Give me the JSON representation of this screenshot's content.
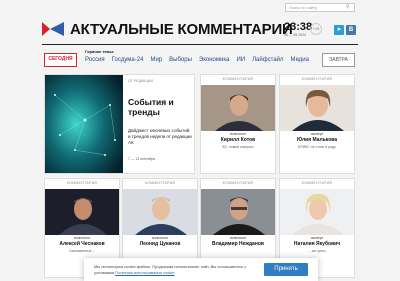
{
  "search": {
    "placeholder": "Поиск по сайту"
  },
  "header": {
    "title": "АКТУАЛЬНЫЕ КОММЕНТАРИИ",
    "time": "23:38",
    "date": "05 … 05 2024",
    "weather": "+15",
    "tg": "tg",
    "vk": "В"
  },
  "nav": {
    "today": "СЕГОДНЯ",
    "tomorrow": "ЗАВТРА",
    "hot_label": "Горячие темы:",
    "items": [
      "Россия",
      "Госдума-24",
      "Мир",
      "Выборы",
      "Экономика",
      "ИИ",
      "Лайфстайл",
      "Медиа"
    ]
  },
  "featured": {
    "tag": "ОТ РЕДАКЦИИ",
    "title": "События и тренды",
    "subtitle": "Дайджест ключевых событий и трендов недели от редакции АК",
    "date": "7 — 13 сентября"
  },
  "cards_row1": [
    {
      "tag": "КОММЕНТАРИЙ",
      "role": "политолог",
      "name": "Кирилл Котов",
      "snippet": "5G, новый импульс"
    },
    {
      "tag": "КОММЕНТАРИЙ",
      "role": "эксперт",
      "name": "Юлия Малькова",
      "snippet": "БРИКС не стоит в ряду"
    }
  ],
  "cards_row2": [
    {
      "tag": "КОММЕНТАРИЙ",
      "role": "политолог",
      "name": "Алексей Чеснаков",
      "snippet": "Самозванные…"
    },
    {
      "tag": "КОММЕНТАРИЙ",
      "role": "политолог",
      "name": "Леонид Цуканов",
      "snippet": ""
    },
    {
      "tag": "КОММЕНТАРИЙ",
      "role": "политолог",
      "name": "Владимир Нежданов",
      "snippet": ""
    },
    {
      "tag": "КОММЕНТАРИЙ",
      "role": "эксперт",
      "name": "Наталия Якубович",
      "snippet": "…ые цены"
    }
  ],
  "cookie": {
    "text": "Мы используем cookie-файлы. Продолжая использовать сайт, Вы соглашаетесь с условиями",
    "link": "Политики использования cookie",
    "accept": "Принять"
  },
  "colors": {
    "accent": "#d8232a",
    "link": "#2a4a8a",
    "button": "#2f7dc2"
  }
}
